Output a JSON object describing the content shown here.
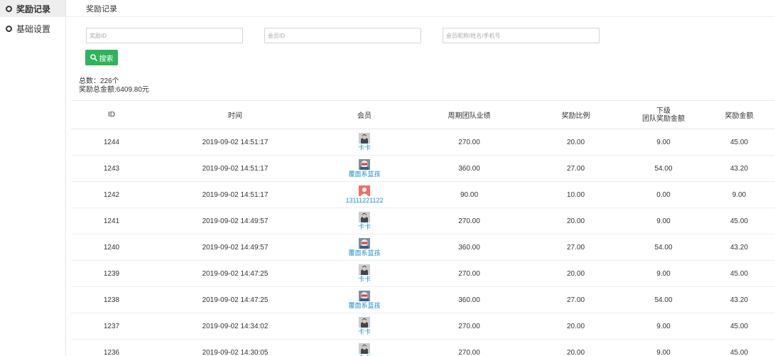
{
  "sidebar": {
    "items": [
      {
        "label": "奖励记录",
        "active": true
      },
      {
        "label": "基础设置",
        "active": false
      }
    ]
  },
  "topbar": {
    "title": "奖励记录"
  },
  "filters": {
    "reward_id_placeholder": "奖励ID",
    "member_id_placeholder": "会员ID",
    "member_name_placeholder": "会员昵称/姓名/手机号",
    "search_label": "搜索"
  },
  "summary": {
    "total_label": "总数：226个",
    "amount_label": "奖励总金额:6409.80元"
  },
  "table": {
    "headers": {
      "id": "ID",
      "time": "时间",
      "member": "会员",
      "team_perf": "周期团队业绩",
      "ratio": "奖励比例",
      "sub_line1": "下级",
      "sub_line2": "团队奖励金额",
      "amount": "奖励金额"
    },
    "rows": [
      {
        "id": "1244",
        "time": "2019-09-02 14:51:17",
        "member": "卡卡",
        "avatar": "hoodie-avatar-icon",
        "team_perf": "270.00",
        "ratio": "20.00",
        "sub": "9.00",
        "amount": "45.00"
      },
      {
        "id": "1243",
        "time": "2019-09-02 14:51:17",
        "member": "覆面系蓝孩",
        "avatar": "masked-avatar-icon",
        "team_perf": "360.00",
        "ratio": "27.00",
        "sub": "54.00",
        "amount": "43.20"
      },
      {
        "id": "1242",
        "time": "2019-09-02 14:51:17",
        "member": "13111221122",
        "avatar": "default-avatar-icon",
        "team_perf": "90.00",
        "ratio": "10.00",
        "sub": "0.00",
        "amount": "9.00"
      },
      {
        "id": "1241",
        "time": "2019-09-02 14:49:57",
        "member": "卡卡",
        "avatar": "hoodie-avatar-icon",
        "team_perf": "270.00",
        "ratio": "20.00",
        "sub": "9.00",
        "amount": "45.00"
      },
      {
        "id": "1240",
        "time": "2019-09-02 14:49:57",
        "member": "覆面系蓝孩",
        "avatar": "masked-avatar-icon",
        "team_perf": "360.00",
        "ratio": "27.00",
        "sub": "54.00",
        "amount": "43.20"
      },
      {
        "id": "1239",
        "time": "2019-09-02 14:47:25",
        "member": "卡卡",
        "avatar": "hoodie-avatar-icon",
        "team_perf": "270.00",
        "ratio": "20.00",
        "sub": "9.00",
        "amount": "45.00"
      },
      {
        "id": "1238",
        "time": "2019-09-02 14:47:25",
        "member": "覆面系蓝孩",
        "avatar": "masked-avatar-icon",
        "team_perf": "360.00",
        "ratio": "27.00",
        "sub": "54.00",
        "amount": "43.20"
      },
      {
        "id": "1237",
        "time": "2019-09-02 14:34:02",
        "member": "卡卡",
        "avatar": "hoodie-avatar-icon",
        "team_perf": "270.00",
        "ratio": "20.00",
        "sub": "9.00",
        "amount": "45.00"
      },
      {
        "id": "1236",
        "time": "2019-09-02 14:30:05",
        "member": "卡卡",
        "avatar": "hoodie-avatar-icon",
        "team_perf": "270.00",
        "ratio": "20.00",
        "sub": "9.00",
        "amount": "45.00"
      }
    ]
  },
  "colors": {
    "accent": "#2eb45c",
    "link": "#1a8fcf",
    "default_avatar": "#ef6f64"
  }
}
